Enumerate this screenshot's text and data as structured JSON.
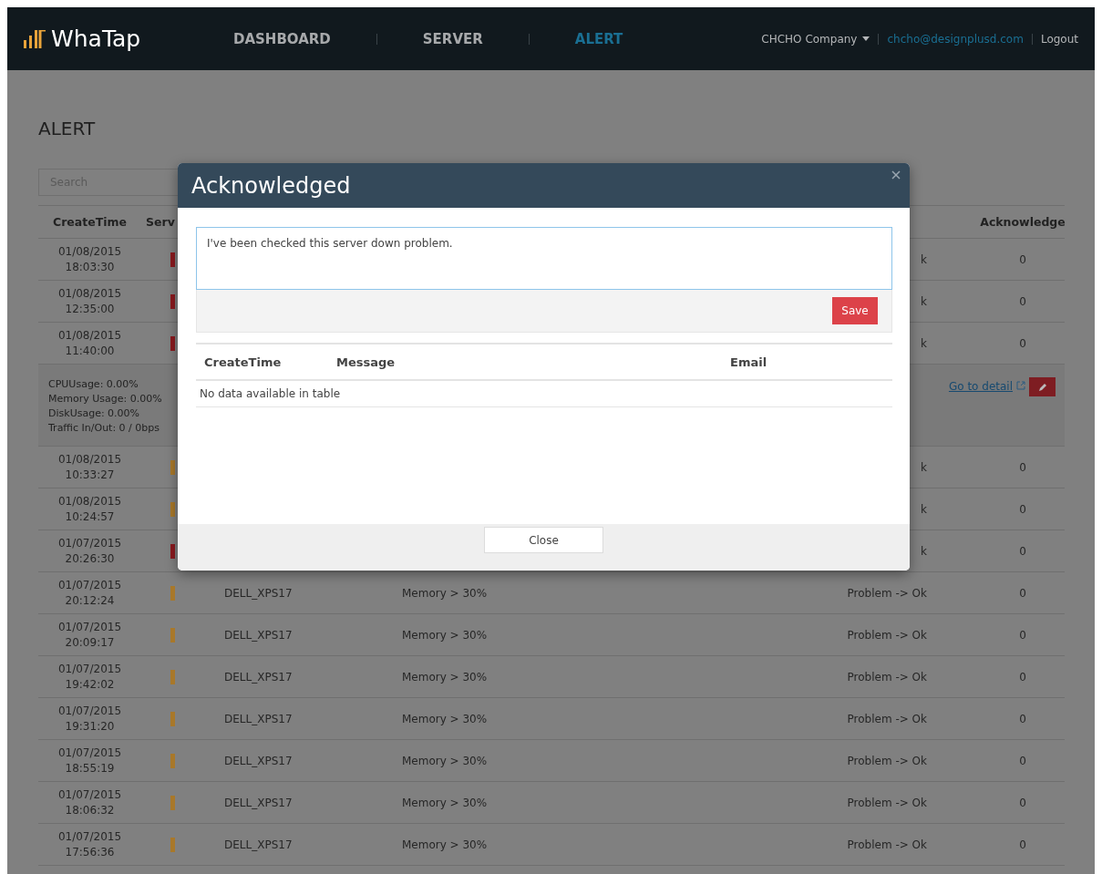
{
  "nav": {
    "logo": "WhaTap",
    "items": [
      {
        "label": "DASHBOARD",
        "selected": false
      },
      {
        "label": "SERVER",
        "selected": false
      },
      {
        "label": "ALERT",
        "selected": true
      }
    ],
    "company": "CHCHO Company",
    "email": "chcho@designplusd.com",
    "logout": "Logout"
  },
  "page": {
    "title": "ALERT",
    "search": {
      "placeholder": "Search"
    }
  },
  "table": {
    "columns": [
      {
        "label": "CreateTime",
        "kind": "time"
      },
      {
        "label": "Serv",
        "kind": "server"
      },
      {
        "label": "Acknowledge",
        "kind": "ack"
      }
    ],
    "rows": [
      {
        "kind": "alert",
        "date": "01/08/2015",
        "time": "18:03:30",
        "color": "#8a1a1f",
        "status": "k",
        "ack": "0"
      },
      {
        "kind": "alert",
        "date": "01/08/2015",
        "time": "12:35:00",
        "color": "#8a1a1f",
        "status": "k",
        "ack": "0"
      },
      {
        "kind": "alert",
        "date": "01/08/2015",
        "time": "11:40:00",
        "color": "#8a1a1f",
        "status": "k",
        "ack": "0"
      },
      {
        "kind": "detail",
        "lines": [
          "CPUUsage: 0.00%",
          "Memory Usage: 0.00%",
          "DiskUsage: 0.00%",
          "Traffic In/Out: 0 / 0bps"
        ],
        "link": "Go to detail"
      },
      {
        "kind": "alert",
        "date": "01/08/2015",
        "time": "10:33:27",
        "color": "#a8782a",
        "status": "k",
        "ack": "0"
      },
      {
        "kind": "alert",
        "date": "01/08/2015",
        "time": "10:24:57",
        "color": "#a8782a",
        "status": "k",
        "ack": "0"
      },
      {
        "kind": "alert",
        "date": "01/07/2015",
        "time": "20:26:30",
        "color": "#8a1a1f",
        "status": "k",
        "ack": "0"
      },
      {
        "kind": "alert",
        "date": "01/07/2015",
        "time": "20:12:24",
        "color": "#a8782a",
        "server": "DELL_XPS17",
        "message": "Memory > 30%",
        "status": "Problem -> Ok",
        "ack": "0"
      },
      {
        "kind": "alert",
        "date": "01/07/2015",
        "time": "20:09:17",
        "color": "#a8782a",
        "server": "DELL_XPS17",
        "message": "Memory > 30%",
        "status": "Problem -> Ok",
        "ack": "0"
      },
      {
        "kind": "alert",
        "date": "01/07/2015",
        "time": "19:42:02",
        "color": "#a8782a",
        "server": "DELL_XPS17",
        "message": "Memory > 30%",
        "status": "Problem -> Ok",
        "ack": "0"
      },
      {
        "kind": "alert",
        "date": "01/07/2015",
        "time": "19:31:20",
        "color": "#a8782a",
        "server": "DELL_XPS17",
        "message": "Memory > 30%",
        "status": "Problem -> Ok",
        "ack": "0"
      },
      {
        "kind": "alert",
        "date": "01/07/2015",
        "time": "18:55:19",
        "color": "#a8782a",
        "server": "DELL_XPS17",
        "message": "Memory > 30%",
        "status": "Problem -> Ok",
        "ack": "0"
      },
      {
        "kind": "alert",
        "date": "01/07/2015",
        "time": "18:06:32",
        "color": "#a8782a",
        "server": "DELL_XPS17",
        "message": "Memory > 30%",
        "status": "Problem -> Ok",
        "ack": "0"
      },
      {
        "kind": "alert",
        "date": "01/07/2015",
        "time": "17:56:36",
        "color": "#a8782a",
        "server": "DELL_XPS17",
        "message": "Memory > 30%",
        "status": "Problem -> Ok",
        "ack": "0"
      }
    ]
  },
  "modal": {
    "title": "Acknowledged",
    "comment": "I've been checked this server down problem.",
    "save": "Save",
    "columns": [
      "CreateTime",
      "Message",
      "Email"
    ],
    "empty": "No data available in table",
    "close": "Close"
  }
}
